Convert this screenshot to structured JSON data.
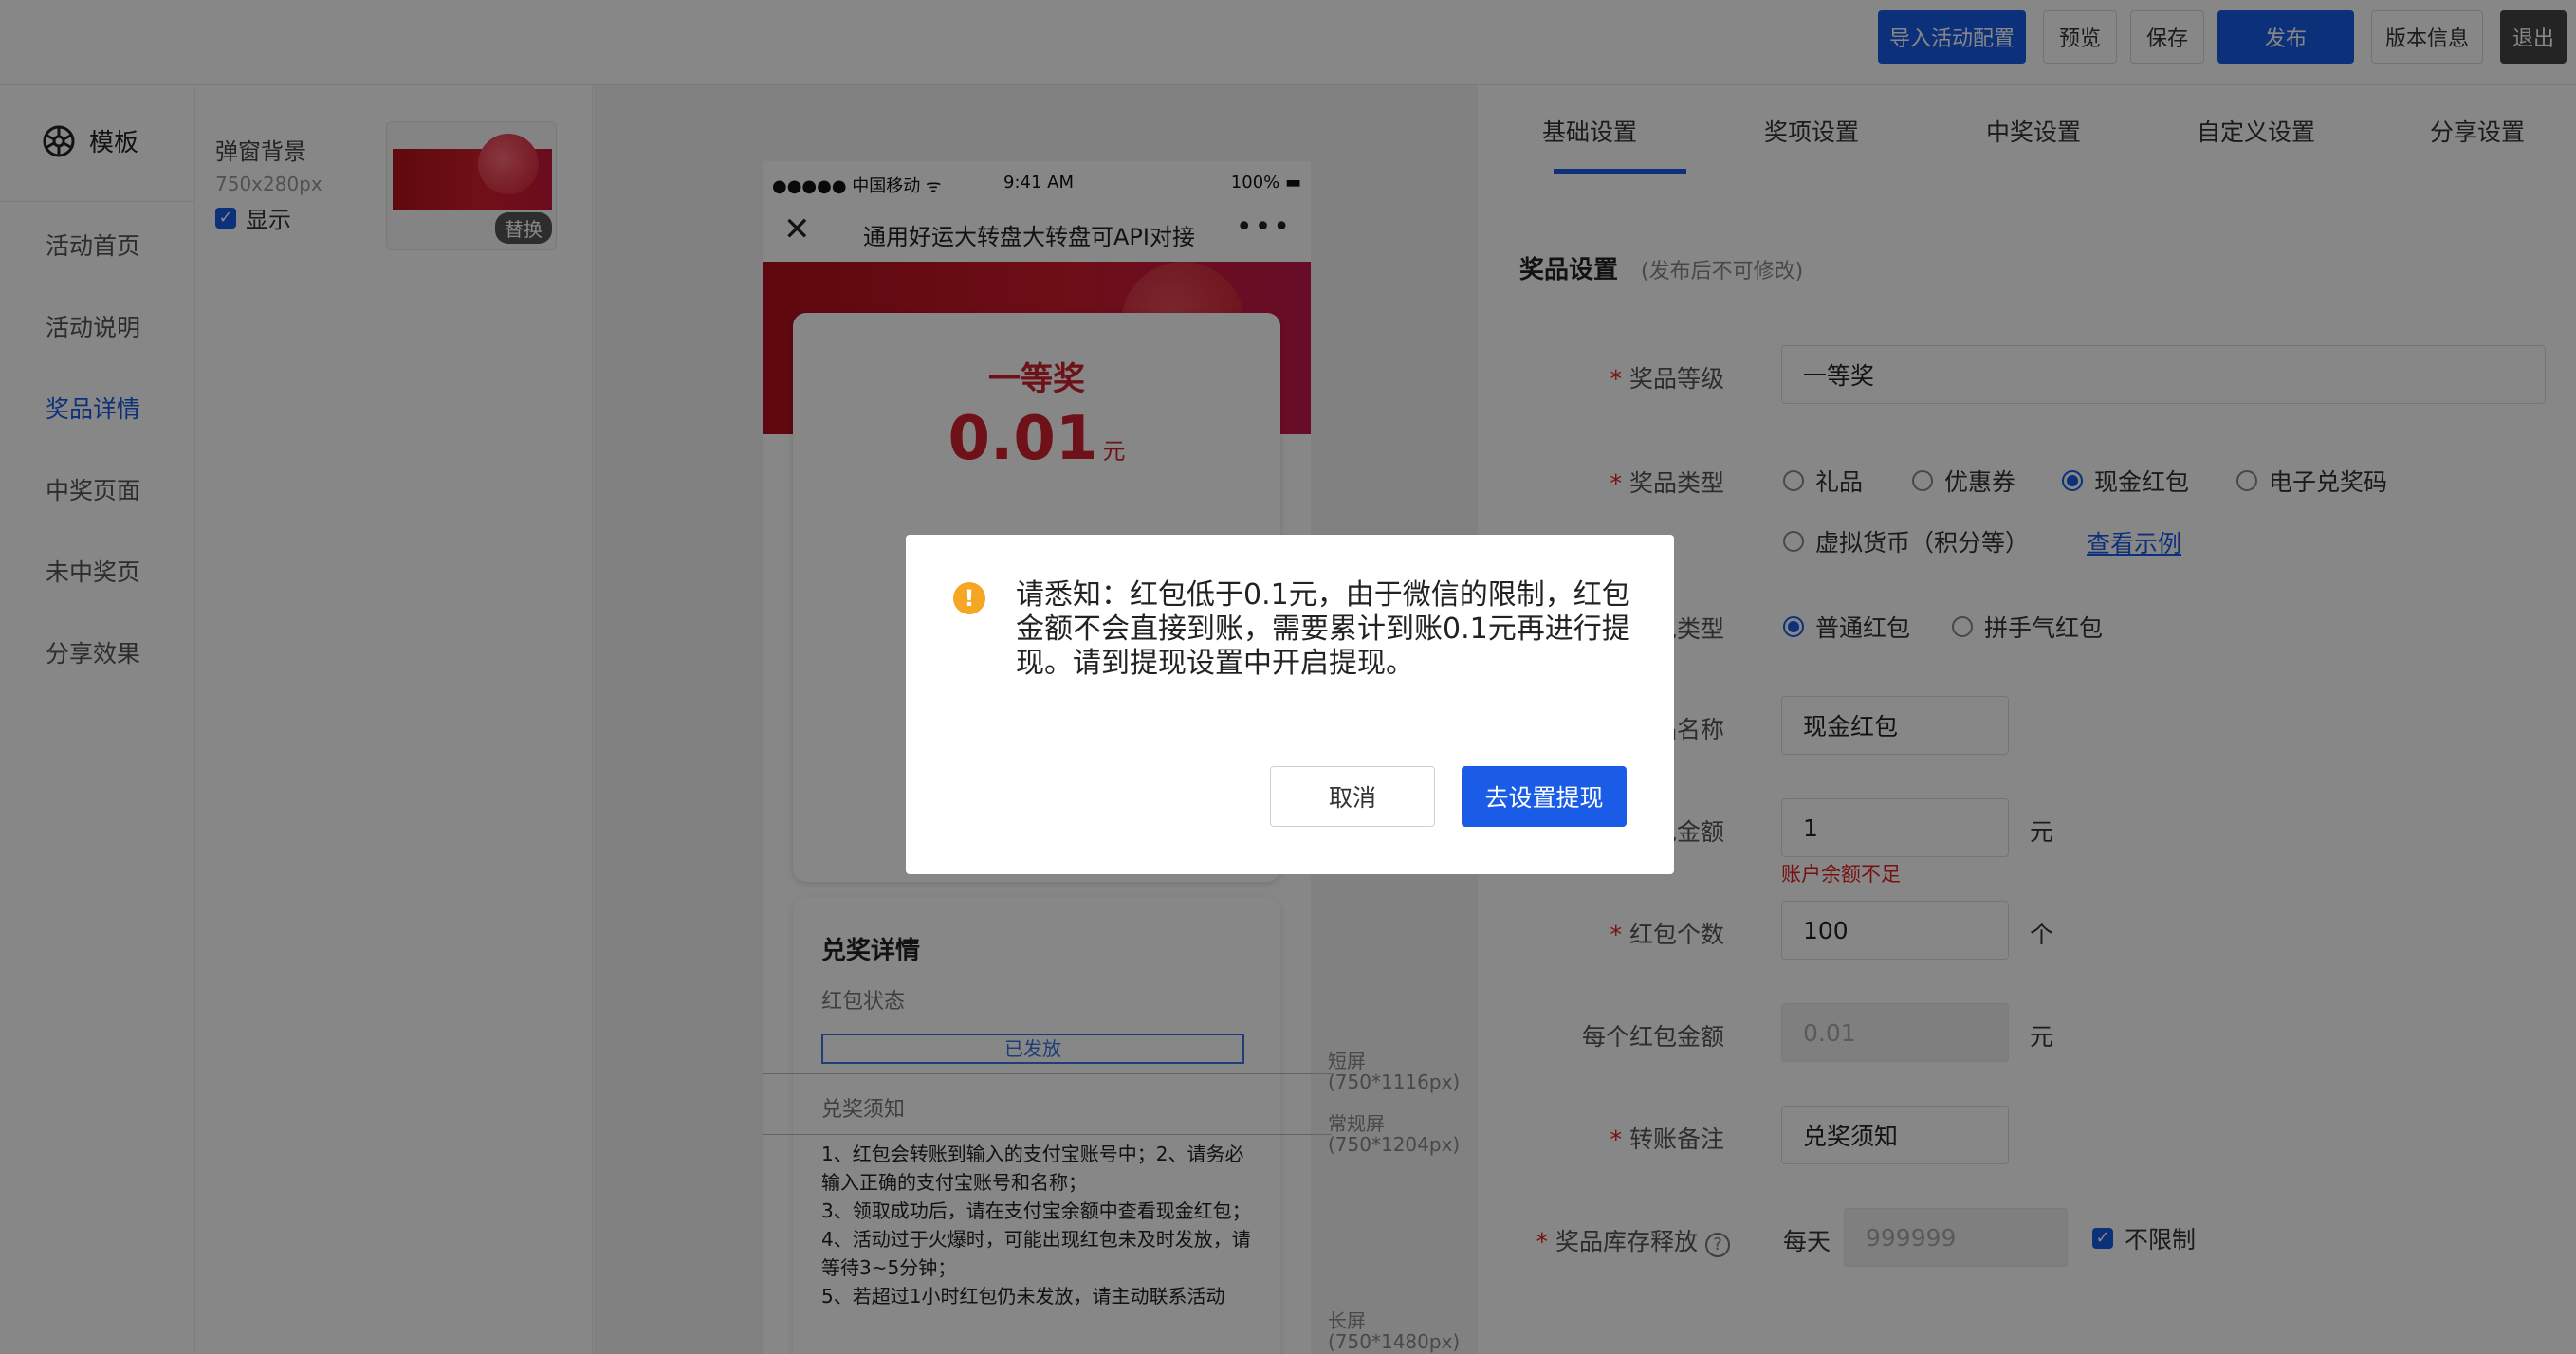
{
  "toolbar": {
    "import_label": "导入活动配置",
    "preview_label": "预览",
    "save_label": "保存",
    "publish_label": "发布",
    "version_label": "版本信息",
    "logout_label": "退出"
  },
  "sidebar": {
    "template_label": "模板",
    "items": [
      {
        "label": "活动首页"
      },
      {
        "label": "活动说明"
      },
      {
        "label": "奖品详情"
      },
      {
        "label": "中奖页面"
      },
      {
        "label": "未中奖页"
      },
      {
        "label": "分享效果"
      }
    ]
  },
  "background_settings": {
    "title": "弹窗背景",
    "size": "750x280px",
    "show_label": "显示",
    "replace_label": "替换"
  },
  "phone": {
    "carrier": "●●●●● 中国移动 ᯤ",
    "time": "9:41 AM",
    "battery": "100% ▬",
    "close_glyph": "✕",
    "page_title": "通用好运大转盘大转盘可API对接",
    "more_glyph": "•••",
    "prize_level": "一等奖",
    "prize_amount": "0.01",
    "prize_unit": "元",
    "detail_title": "兑奖详情",
    "status_label": "红包状态",
    "status_value": "已发放",
    "notes_title": "兑奖须知",
    "notes": "1、红包会转账到输入的支付宝账号中；2、请务必输入正确的支付宝账号和名称；\n3、领取成功后，请在支付宝余额中查看现金红包；\n4、活动过于火爆时，可能出现红包未及时发放，请等待3~5分钟；\n5、若超过1小时红包仍未发放，请主动联系活动"
  },
  "guides": {
    "short": "短屏\n(750*1116px)",
    "normal": "常规屏\n(750*1204px)",
    "long": "长屏\n(750*1480px)"
  },
  "tabs": [
    {
      "label": "基础设置"
    },
    {
      "label": "奖项设置"
    },
    {
      "label": "中奖设置"
    },
    {
      "label": "自定义设置"
    },
    {
      "label": "分享设置"
    }
  ],
  "form": {
    "section_title": "奖品设置",
    "section_note": "(发布后不可修改)",
    "level_label": "奖品等级",
    "level_value": "一等奖",
    "type_label": "奖品类型",
    "type_options": [
      "礼品",
      "优惠券",
      "现金红包",
      "电子兑奖码",
      "虚拟货币（积分等）"
    ],
    "type_example_link": "查看示例",
    "redpack_type_label": "红包类型",
    "redpack_options": [
      "普通红包",
      "拼手气红包"
    ],
    "name_label": "奖品名称",
    "name_value": "现金红包",
    "amount_label": "红包金额",
    "amount_value": "1",
    "amount_unit": "元",
    "amount_error": "账户余额不足",
    "count_label": "红包个数",
    "count_value": "100",
    "count_unit": "个",
    "each_label": "每个红包金额",
    "each_value": "0.01",
    "each_unit": "元",
    "remark_label": "转账备注",
    "remark_value": "兑奖须知",
    "stock_label": "奖品库存释放",
    "stock_per_day": "每天",
    "stock_placeholder": "999999",
    "stock_unlimited": "不限制"
  },
  "modal": {
    "message": "请悉知：红包低于0.1元，由于微信的限制，红包金额不会直接到账，需要累计到账0.1元再进行提现。请到提现设置中开启提现。",
    "cancel_label": "取消",
    "confirm_label": "去设置提现"
  },
  "colors": {
    "accent": "#1a5ce6",
    "prize_red": "#d0202e",
    "warning": "#f5a623",
    "error": "#e02020"
  }
}
